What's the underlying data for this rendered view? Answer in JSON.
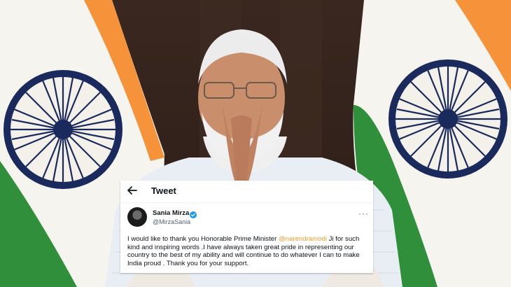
{
  "tweet": {
    "header_title": "Tweet",
    "user_name": "Sania Mirza",
    "user_handle": "@MirzaSania",
    "text_before": "I would like to thank you Honorable Prime Minister ",
    "mention": "@narendramodi",
    "text_after": " Ji for such kind and inspiring words .I have always taken great pride in representing our country to the best of my ability and will continue to do whatever I can to make India proud .  Thank you for your support.",
    "icons": [
      "back-arrow-icon",
      "verified-badge-icon",
      "more-options-icon"
    ]
  },
  "colors": {
    "saffron": "#f6933a",
    "india_green": "#2f8f3a",
    "chakra_navy": "#1b2a5c",
    "verified_blue": "#1d9bf0",
    "mention_orange": "#f39c2e"
  }
}
